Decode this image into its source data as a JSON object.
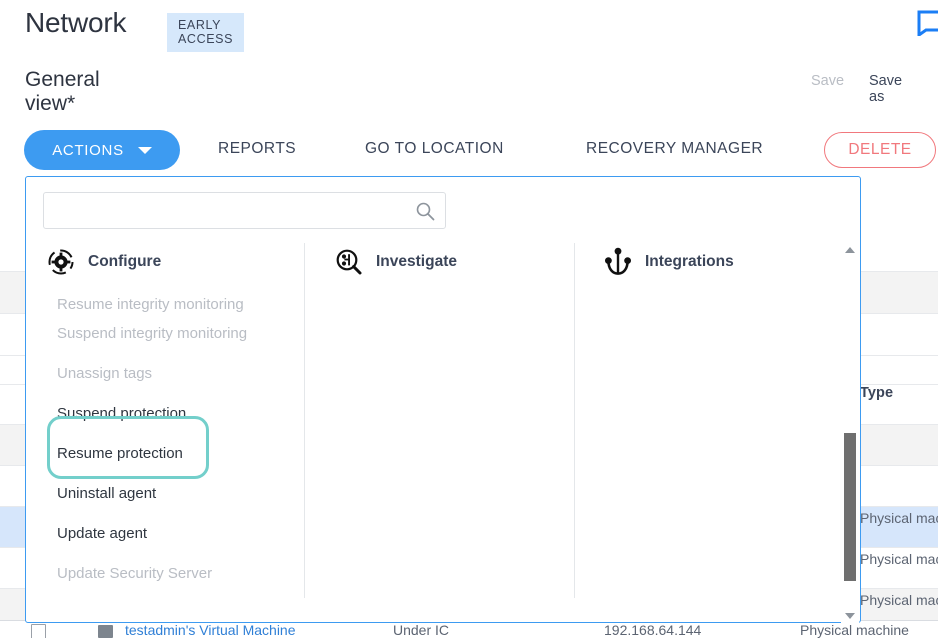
{
  "header": {
    "title": "Network",
    "badge": "EARLY ACCESS",
    "subtitle": "General view*",
    "save_label": "Save",
    "save_as_label": "Save as",
    "bookmark_icon": "bookmark-icon"
  },
  "toolbar": {
    "actions_label": "ACTIONS",
    "tabs": [
      {
        "label": "REPORTS"
      },
      {
        "label": "GO TO LOCATION"
      },
      {
        "label": "RECOVERY MANAGER"
      }
    ],
    "delete_label": "DELETE",
    "accent_blue": "#3d9bf1",
    "delete_red": "#f1787d"
  },
  "dropdown": {
    "search": {
      "value": "",
      "placeholder": "",
      "icon": "search-icon"
    },
    "columns": [
      {
        "name": "configure",
        "title": "Configure",
        "icon": "gear-circle-icon",
        "items": [
          {
            "label": "Resume integrity monitoring",
            "disabled": true
          },
          {
            "label": "Suspend integrity monitoring",
            "disabled": true
          },
          {
            "label": "Unassign tags",
            "disabled": true
          },
          {
            "label": "Suspend protection",
            "disabled": false
          },
          {
            "label": "Resume protection",
            "disabled": false
          },
          {
            "label": "Uninstall agent",
            "disabled": false
          },
          {
            "label": "Update agent",
            "disabled": false
          },
          {
            "label": "Update Security Server",
            "disabled": true
          }
        ]
      },
      {
        "name": "investigate",
        "title": "Investigate",
        "icon": "magnifier-graph-icon",
        "items": []
      },
      {
        "name": "integrations",
        "title": "Integrations",
        "icon": "anchor-integrations-icon",
        "items": []
      }
    ],
    "highlight_color": "#73cfcb",
    "scrollbar": {
      "up_icon": "caret-up-icon",
      "down_icon": "caret-down-icon"
    }
  },
  "background_table": {
    "type_header": "Type",
    "type_values": [
      "Physical machine",
      "Physical machine",
      "Physical machine"
    ],
    "bottom_row": {
      "name": "testadmin's Virtual Machine",
      "group": "Under IC",
      "ip": "192.168.64.144",
      "type": "Physical machine"
    }
  }
}
